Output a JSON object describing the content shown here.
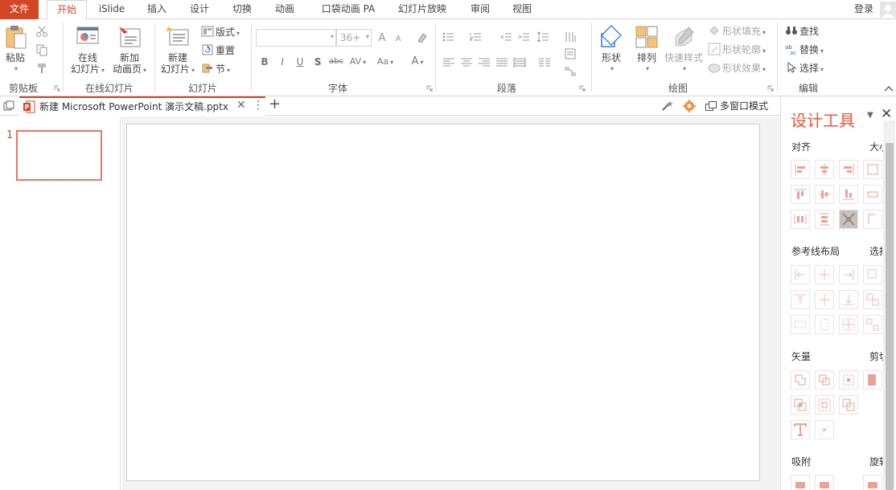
{
  "tabs": {
    "file": "文件",
    "home": "开始",
    "islide": "iSlide",
    "insert": "插入",
    "design": "设计",
    "transitions": "切换",
    "animations": "动画",
    "pocket": "口袋动画 PA",
    "slideshow": "幻灯片放映",
    "review": "审阅",
    "view": "视图"
  },
  "account": {
    "login": "登录"
  },
  "clipboard": {
    "paste": "粘贴",
    "group_label": "剪贴板"
  },
  "online_slides": {
    "online": "在线",
    "slides": "幻灯片",
    "new_add": "新加",
    "anim_page": "动画页",
    "group_label": "在线幻灯片"
  },
  "slides": {
    "new": "新建",
    "slide": "幻灯片",
    "layout": "版式",
    "reset": "重置",
    "section": "节",
    "group_label": "幻灯片"
  },
  "font": {
    "size": "36+",
    "group_label": "字体",
    "bold": "B",
    "italic": "I",
    "underline": "U",
    "shadow": "S",
    "strike": "abc",
    "spacing": "AV",
    "case": "Aa",
    "color": "A"
  },
  "paragraph": {
    "group_label": "段落"
  },
  "drawing": {
    "shape": "形状",
    "arrange": "排列",
    "quick_style": "快速样式",
    "shape_fill": "形状填充",
    "shape_outline": "形状轮廓",
    "shape_effect": "形状效果",
    "group_label": "绘图"
  },
  "editing": {
    "find": "查找",
    "replace": "替换",
    "select": "选择",
    "group_label": "编辑"
  },
  "document": {
    "title": "新建 Microsoft PowerPoint 演示文稿.pptx",
    "multi_window": "多窗口模式"
  },
  "thumbnails": {
    "slide_number": "1"
  },
  "panel": {
    "title": "设计工具",
    "align": "对齐",
    "size_cut": "大小",
    "guides": "参考线布局",
    "select_cut": "选择",
    "vector": "矢量",
    "clip_cut": "剪切",
    "snap": "吸附",
    "rotate_cut": "旋转"
  },
  "colors": {
    "accent": "#D24726",
    "panel_accent": "#E8553C"
  }
}
